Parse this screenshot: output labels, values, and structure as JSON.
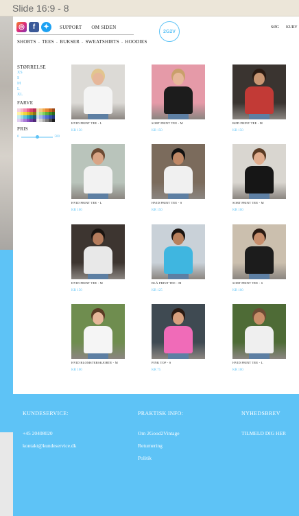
{
  "window": {
    "title": "Slide 16:9 - 8"
  },
  "header": {
    "social": [
      {
        "icon": "instagram-icon",
        "glyph": "◎"
      },
      {
        "icon": "facebook-icon",
        "glyph": "f"
      },
      {
        "icon": "twitter-icon",
        "glyph": "✦"
      }
    ],
    "nav": [
      "SUPPORT",
      "OM SIDEN"
    ],
    "logo_text": "2G2V",
    "right_nav": [
      "SØG",
      "KURV"
    ]
  },
  "categories": [
    "SHORTS",
    "TEES",
    "BUKSER",
    "SWEATSHIRTS",
    "HOODIES"
  ],
  "category_separator": "-",
  "filters": {
    "size_title": "STØRRELSE",
    "sizes": [
      "XS",
      "S",
      "M",
      "L",
      "XL"
    ],
    "color_title": "FARVE",
    "price_title": "PRIS",
    "price_min": "0",
    "price_max": "500"
  },
  "colors": {
    "accent": "#5ec3f6",
    "swatches": [
      "#f4d3e0",
      "#f6b6c8",
      "#f38fb0",
      "#ee5f8e",
      "#d8436c",
      "#b52f54",
      "#f7e0b4",
      "#f5c983",
      "#f0a94b",
      "#e8862e",
      "#c96521",
      "#9b4a19",
      "#fff3a8",
      "#fbe86c",
      "#f2d43c",
      "#dbba24",
      "#b7991a",
      "#8a7414",
      "#d6f0b8",
      "#aee38a",
      "#82cf5d",
      "#5bb23c",
      "#3e8e2a",
      "#2b6a1e",
      "#c5ecf2",
      "#96dde8",
      "#5ec3d6",
      "#2ea5bf",
      "#1b82a0",
      "#145e78",
      "#cfd8f6",
      "#a6b6ef",
      "#7890e2",
      "#4f6ccf",
      "#3550ad",
      "#243a84",
      "#e2cff2",
      "#c7a6e6",
      "#a97bd6",
      "#8b54c2",
      "#6c3aa0",
      "#4f2878",
      "#f2f2f2",
      "#d4d4d4",
      "#a8a8a8",
      "#7c7c7c",
      "#4e4e4e",
      "#1e1e1e"
    ]
  },
  "products": [
    {
      "name": "HVID PRINT TEE - L",
      "price": "KR 150",
      "bg": "#dcdad6",
      "shirt": "#f4f4f4",
      "skin": "#e6b79a",
      "hair": "#e2c58e"
    },
    {
      "name": "SORT PRINT TEE - M",
      "price": "KR 150",
      "bg": "#e59aa8",
      "shirt": "#1c1c1c",
      "skin": "#e6b79a",
      "hair": "#c9a06b"
    },
    {
      "name": "RØD PRINT TEE - M",
      "price": "KR 150",
      "bg": "#3a3430",
      "shirt": "#c23a36",
      "skin": "#c99673",
      "hair": "#2a1a12"
    },
    {
      "name": "HVID PRINT TEE - L",
      "price": "KR 100",
      "bg": "#b9c4bb",
      "shirt": "#f2f2f2",
      "skin": "#d9a586",
      "hair": "#6d4b34"
    },
    {
      "name": "HVID PRINT TEE - S",
      "price": "KR 150",
      "bg": "#7b6b5c",
      "shirt": "#f0f0f0",
      "skin": "#c08866",
      "hair": "#111111"
    },
    {
      "name": "SORT PRINT TEE - M",
      "price": "KR 100",
      "bg": "#d9d6d0",
      "shirt": "#161616",
      "skin": "#e0ad8e",
      "hair": "#5a3b24"
    },
    {
      "name": "HVID PRINT TEE - M",
      "price": "KR 150",
      "bg": "#3d3530",
      "shirt": "#e8e8e8",
      "skin": "#b57c5c",
      "hair": "#1a1410"
    },
    {
      "name": "BLÅ PRINT TEE - M",
      "price": "KR 125",
      "bg": "#c9d1d8",
      "shirt": "#3fb6e0",
      "skin": "#b8805c",
      "hair": "#1a1410"
    },
    {
      "name": "SORT PRINT TEE - S",
      "price": "KR 100",
      "bg": "#cbbfae",
      "shirt": "#1c1c1c",
      "skin": "#c88e6c",
      "hair": "#2a1a12"
    },
    {
      "name": "HVID BLOMSTERSKJORTE - M",
      "price": "KR 100",
      "bg": "#6f8d4f",
      "shirt": "#f5f5f5",
      "skin": "#e6b79a",
      "hair": "#5a3b24"
    },
    {
      "name": "PINK TOP - S",
      "price": "KR 75",
      "bg": "#3f4a52",
      "shirt": "#f06bb8",
      "skin": "#d7a07e",
      "hair": "#2a1a12"
    },
    {
      "name": "HVID PRINT TEE - L",
      "price": "KR 100",
      "bg": "#4e6b36",
      "shirt": "#efefef",
      "skin": "#c98f6a",
      "hair": "#6d4b34"
    }
  ],
  "footer": {
    "customer_service": {
      "title": "KUNDESERVICE:",
      "phone": "+45 20408020",
      "email": "kontakt@kundeservice.dk"
    },
    "practical": {
      "title": "PRAKTISK INFO:",
      "items": [
        "Om 2Good2Vintage",
        "Returnering",
        "Politik"
      ]
    },
    "newsletter": {
      "title": "NYHEDSBREV",
      "signup": "TILMELD DIG HER"
    }
  }
}
